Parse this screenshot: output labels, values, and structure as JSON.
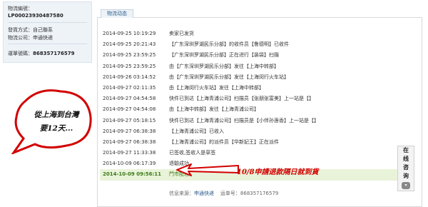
{
  "sidebar": {
    "tracking_label": "物流編號：",
    "tracking_number": "LP00023930487580",
    "method_label": "發貨方式：",
    "method_value": "自己聯系",
    "company_label": "物流公司：",
    "company_value": "申通快递",
    "waybill_label": "運單號碼：",
    "waybill_value": "868357176579"
  },
  "tab": {
    "label": "物流动态"
  },
  "timeline": [
    {
      "time": "2014-09-25 10:19:29",
      "desc": "卖家已发货"
    },
    {
      "time": "2014-09-25 20:21:43",
      "desc": "【广东深圳罗湖民乐分部】的收件员【鲁德明】已收件"
    },
    {
      "time": "2014-09-25 23:59:25",
      "desc": "【广东深圳罗湖民乐分部】正在进行【装袋】扫描"
    },
    {
      "time": "2014-09-25 23:59:25",
      "desc": "由【广东深圳罗湖民乐分部】发往【上海中转部】"
    },
    {
      "time": "2014-09-26 03:14:52",
      "desc": "由【广东深圳罗湖民乐分部】发往【上海闵行火车站】"
    },
    {
      "time": "2014-09-27 02:11:35",
      "desc": "由【上海闵行火车站】发往【上海中转部】"
    },
    {
      "time": "2014-09-27 04:54:58",
      "desc": "快件已到达【上海青浦公司】扫描员【张朋张富美】上一站是【】"
    },
    {
      "time": "2014-09-27 04:54:08",
      "desc": "由【上海中转部】发往【上海青浦公司】"
    },
    {
      "time": "2014-09-27 05:18:15",
      "desc": "快件已到达【上海青浦公司】扫描员是【小伴孙莲香】上一站是【】"
    },
    {
      "time": "2014-09-27 06:38:38",
      "desc": "【上海青浦公司】已收入"
    },
    {
      "time": "2014-09-27 06:38:38",
      "desc": "【上海青浦公司】的派件员【华新妃王】正在派件"
    },
    {
      "time": "2014-09-27 11:33:38",
      "desc": "已签收,签收人是草签"
    },
    {
      "time": "2014-10-09 06:17:39",
      "desc": "退驗成功"
    },
    {
      "time": "2014-10-09 09:56:11",
      "desc": "門市配達"
    }
  ],
  "source": {
    "label": "信息来源：",
    "company": "申通快递",
    "waybill_label": "运单号：",
    "waybill": "868357176579"
  },
  "annotations": {
    "bubble_line1": "從上海到台灣",
    "bubble_line2": "要12天...",
    "callout": "10/8申請退款隔日就到貨"
  },
  "side_button": {
    "chars": [
      "在",
      "线",
      "咨",
      "询"
    ]
  },
  "colors": {
    "accent_red": "#d20000",
    "highlight_green": "#3b7a1a",
    "link_blue": "#2a5b8c"
  }
}
